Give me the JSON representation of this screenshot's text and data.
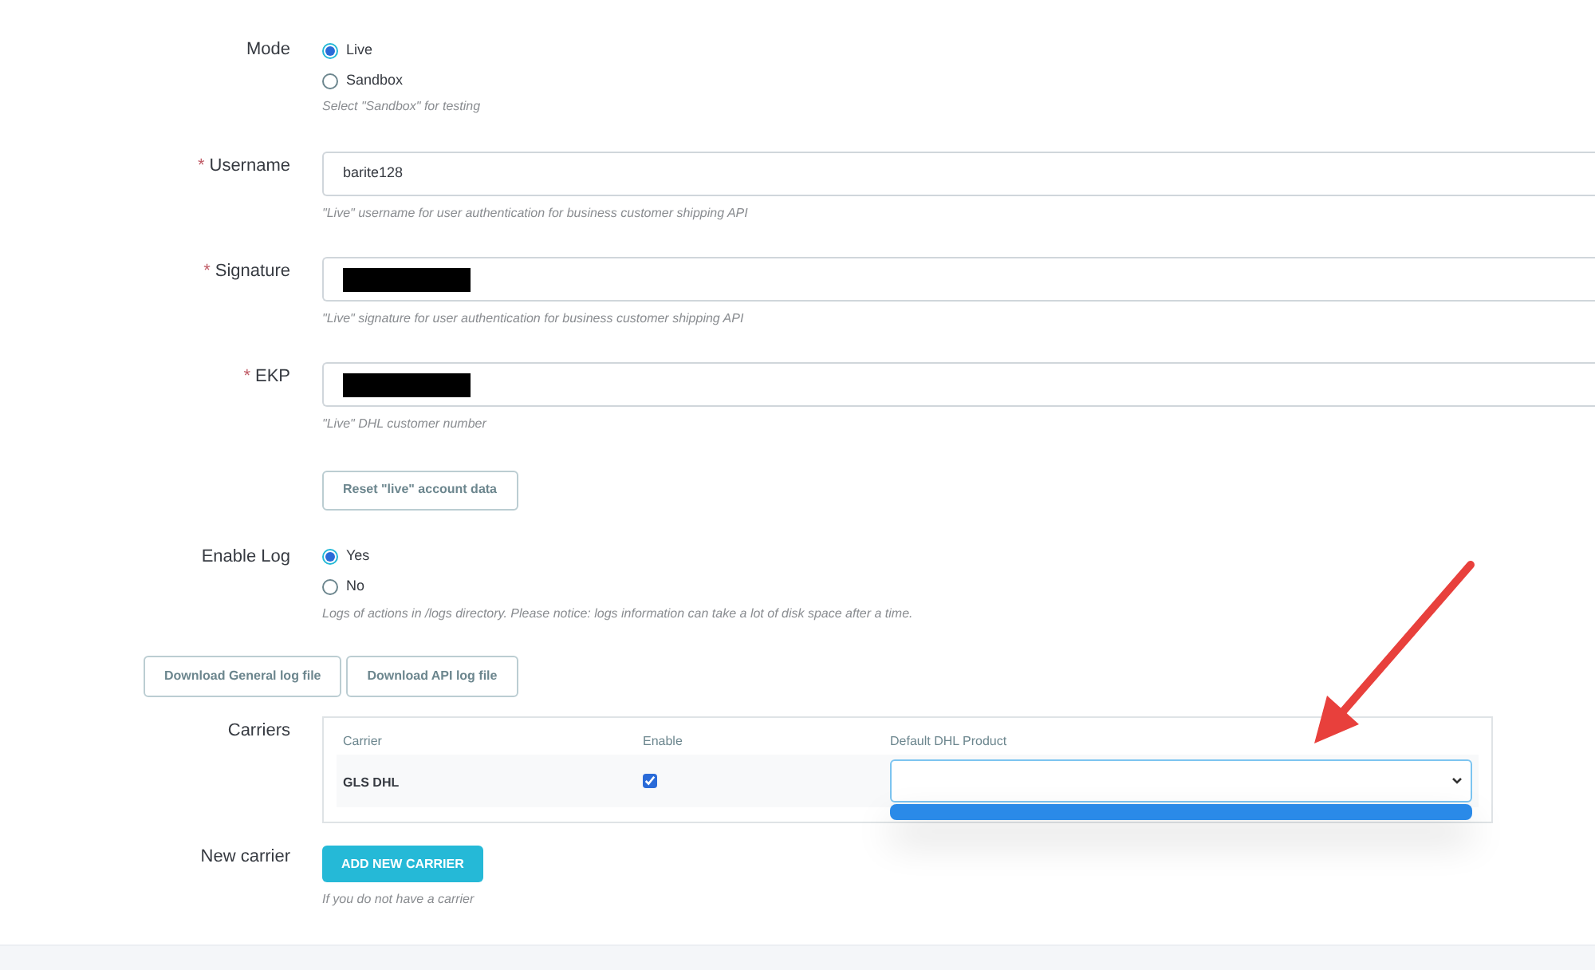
{
  "fields": [
    {
      "kind": "radio",
      "label": "Mode",
      "options": [
        {
          "label": "Live",
          "selected": true
        },
        {
          "label": "Sandbox",
          "selected": false
        }
      ],
      "help": "Select \"Sandbox\" for testing"
    },
    {
      "kind": "text",
      "label": "Username",
      "required_mark": "*",
      "value": "barite128",
      "help": "\"Live\" username for user authentication for business customer shipping API"
    },
    {
      "kind": "text",
      "label": "Signature",
      "required_mark": "*",
      "redacted": true,
      "help": "\"Live\" signature for user authentication for business customer shipping API"
    },
    {
      "kind": "text",
      "label": "EKP",
      "required_mark": "*",
      "redacted": true,
      "help": "\"Live\" DHL customer number"
    },
    {
      "kind": "button",
      "label_button": "Reset \"live\" account data"
    },
    {
      "kind": "radio",
      "label": "Enable Log",
      "options": [
        {
          "label": "Yes",
          "selected": true
        },
        {
          "label": "No",
          "selected": false
        }
      ],
      "help": "Logs of actions in /logs directory. Please notice: logs information can take a lot of disk space after a time."
    }
  ],
  "download_buttons": [
    "Download General log file",
    "Download API log file"
  ],
  "carriers": {
    "label": "Carriers",
    "columns": [
      "Carrier",
      "Enable",
      "Default DHL Product"
    ],
    "rows": [
      {
        "carrier": "GLS DHL",
        "enabled": true,
        "dropdown_open": true
      }
    ]
  },
  "new_carrier": {
    "label": "New carrier",
    "button": "ADD NEW CARRIER",
    "help": "If you do not have a carrier"
  }
}
